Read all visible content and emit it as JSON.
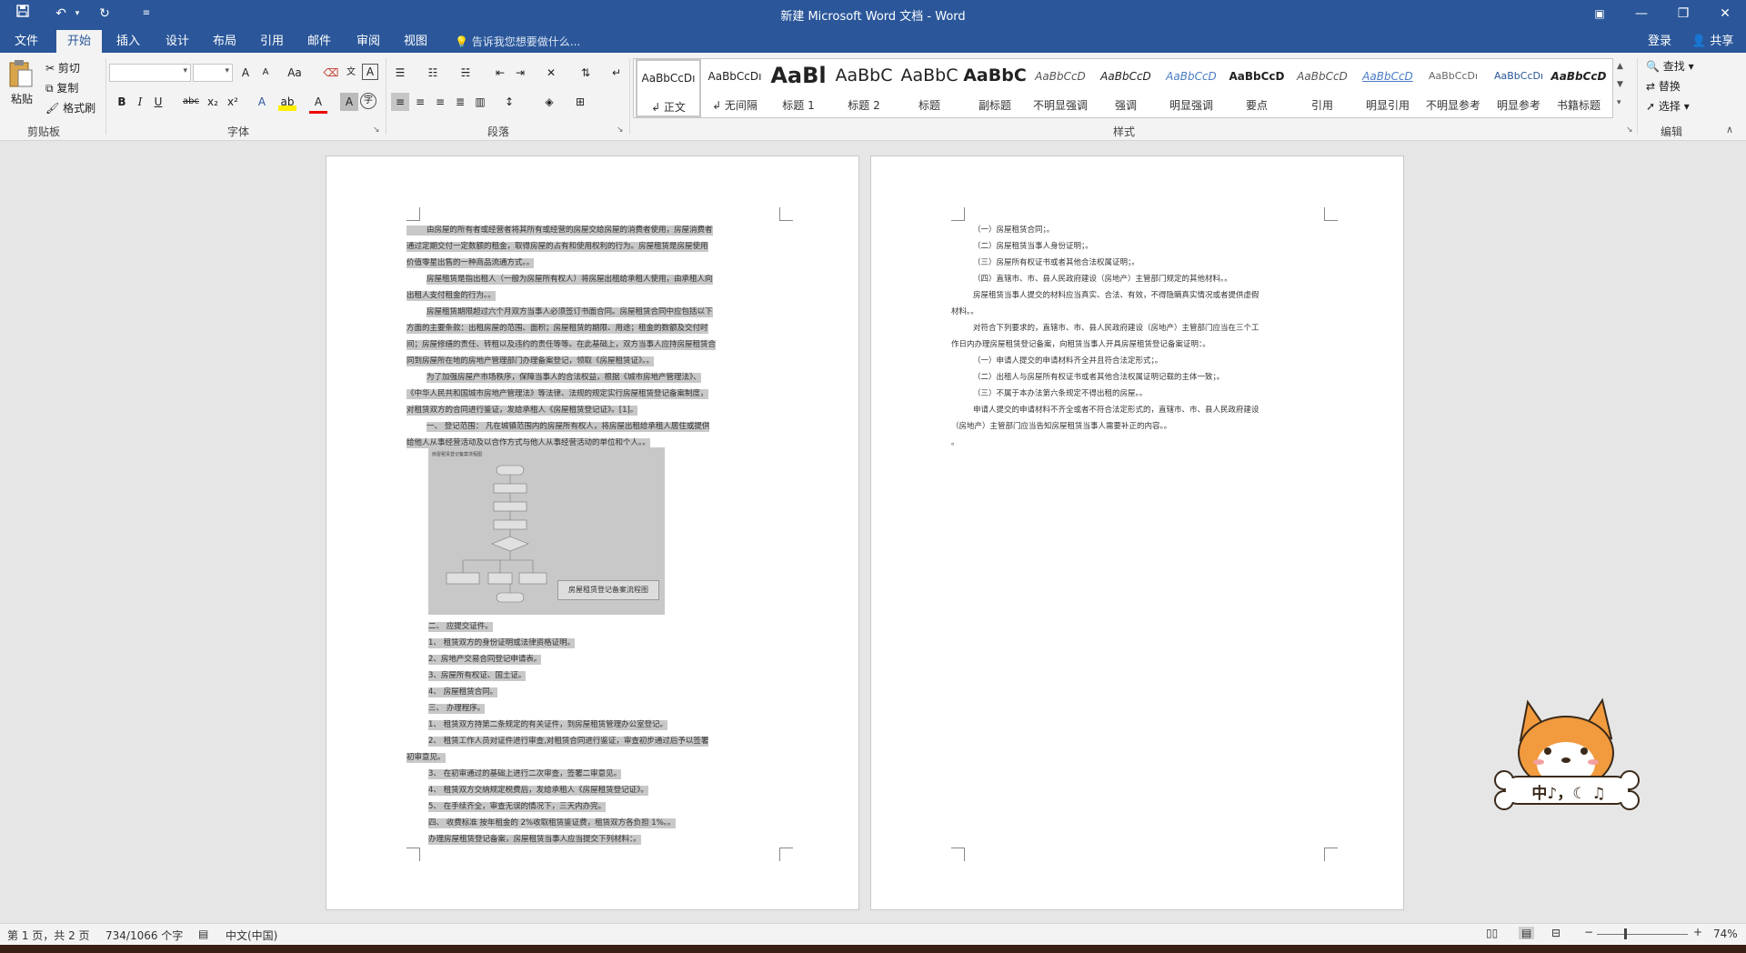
{
  "app": {
    "title": "新建 Microsoft Word 文档 - Word"
  },
  "quick_access": {
    "save_icon": "save-icon",
    "undo_icon": "undo-icon",
    "redo_icon": "redo-icon",
    "customize_icon": "customize-icon"
  },
  "tabs": [
    "文件",
    "开始",
    "插入",
    "设计",
    "布局",
    "引用",
    "邮件",
    "审阅",
    "视图"
  ],
  "active_tab": "开始",
  "tell_me": "告诉我您想要做什么...",
  "account": {
    "login": "登录",
    "share": "共享"
  },
  "clipboard": {
    "paste": "粘贴",
    "cut": "剪切",
    "copy": "复制",
    "format_painter": "格式刷",
    "label": "剪贴板"
  },
  "font": {
    "label": "字体",
    "name": "",
    "size": "",
    "grow": "A",
    "shrink": "A",
    "case": "Aa",
    "bold": "B",
    "italic": "I",
    "underline": "U",
    "strike": "abc",
    "sub": "x₂",
    "sup": "x²"
  },
  "paragraph": {
    "label": "段落"
  },
  "styles": {
    "label": "样式",
    "items": [
      {
        "preview": "AaBbCcDı",
        "name": "↲ 正文"
      },
      {
        "preview": "AaBbCcDı",
        "name": "↲ 无间隔"
      },
      {
        "preview": "AaBl",
        "name": "标题 1"
      },
      {
        "preview": "AaBbC",
        "name": "标题 2"
      },
      {
        "preview": "AaBbC",
        "name": "标题"
      },
      {
        "preview": "AaBbC",
        "name": "副标题"
      },
      {
        "preview": "AaBbCcD",
        "name": "不明显强调"
      },
      {
        "preview": "AaBbCcD",
        "name": "强调"
      },
      {
        "preview": "AaBbCcD",
        "name": "明显强调"
      },
      {
        "preview": "AaBbCcD",
        "name": "要点"
      },
      {
        "preview": "AaBbCcD",
        "name": "引用"
      },
      {
        "preview": "AaBbCcD",
        "name": "明显引用"
      },
      {
        "preview": "AaBbCcDı",
        "name": "不明显参考"
      },
      {
        "preview": "AaBbCcDı",
        "name": "明显参考"
      },
      {
        "preview": "AaBbCcD",
        "name": "书籍标题"
      }
    ]
  },
  "editing": {
    "label": "编辑",
    "find": "查找",
    "replace": "替换",
    "select": "选择"
  },
  "page1": {
    "lines": [
      "由房屋的所有者或经营者将其所有或经营的房屋交给房屋的消费者使用，房屋消费者",
      "通过定期交付一定数额的租金，取得房屋的占有和使用权利的行为。房屋租赁是房屋使用",
      "价值零星出售的一种商品流通方式。。",
      "房屋租赁是指出租人（一般为房屋所有权人）将房屋出租给承租人使用，由承租人向",
      "出租人支付租金的行为。。",
      "房屋租赁期限超过六个月双方当事人必须签订书面合同。房屋租赁合同中应包括以下",
      "方面的主要条款：出租房屋的范围、面积；房屋租赁的期限、用途；租金的数额及交付时",
      "间；房屋修缮的责任、转租以及违约的责任等等。在此基础上，双方当事人应持房屋租赁合",
      "同到房屋所在地的房地产管理部门办理备案登记，领取《房屋租赁证》。。",
      "为了加强房屋产市场秩序，保障当事人的合法权益，根据《城市房地产管理法》、",
      "《中华人民共和国城市房地产管理法》等法律、法规的规定实行房屋租赁登记备案制度，",
      "对租赁双方的合同进行鉴证，发给承租人《房屋租赁登记证》。[1]。",
      "一、 登记范围： 凡在城镇范围内的房屋所有权人，将房屋出租给承租人居住或提供",
      "给他人从事经营活动及以合作方式与他人从事经营活动的单位和个人。。"
    ],
    "flowchart_caption": "房屋租赁登记备案流程图",
    "flowchart_title": "房屋租赁登记备案流程图",
    "list": [
      "二、 应提交证件。",
      "1、 租赁双方的身份证明或法律资格证明。",
      "2、房地产交易合同登记申请表。",
      "3、房屋所有权证、国土证。",
      "4、 房屋租赁合同。",
      "三、 办理程序。",
      "1、 租赁双方持第二条规定的有关证件，到房屋租赁管理办公室登记。",
      "2、 租赁工作人员对证件进行审查,对租赁合同进行鉴证，审查初步通过后予以签署",
      "初审意见。",
      "3、 在初审通过的基础上进行二次审查，签署二审意见。",
      "4、 租赁双方交纳规定税费后，发给承租人《房屋租赁登记证》。",
      "5、 在手续齐全，审查无误的情况下，三天内办完。",
      "四、 收费标准 按年租金的 2%收取租赁鉴证费，租赁双方各负担 1%。。",
      "办理房屋租赁登记备案，房屋租赁当事人应当提交下列材料：。"
    ]
  },
  "page2": {
    "lines": [
      "（一）房屋租赁合同；。",
      "（二）房屋租赁当事人身份证明；。",
      "（三）房屋所有权证书或者其他合法权属证明；。",
      "（四）直辖市、市、县人民政府建设（房地产）主管部门规定的其他材料。。",
      "房屋租赁当事人提交的材料应当真实、合法、有效，不得隐瞒真实情况或者提供虚假",
      "材料。。",
      "对符合下列要求的，直辖市、市、县人民政府建设（房地产）主管部门应当在三个工",
      "作日内办理房屋租赁登记备案，向租赁当事人开具房屋租赁登记备案证明：。",
      "（一）申请人提交的申请材料齐全并且符合法定形式；。",
      "（二）出租人与房屋所有权证书或者其他合法权属证明记载的主体一致；。",
      "（三）不属于本办法第六条规定不得出租的房屋。。",
      "申请人提交的申请材料不齐全或者不符合法定形式的，直辖市、市、县人民政府建设",
      "（房地产）主管部门应当告知房屋租赁当事人需要补正的内容。。",
      "。"
    ]
  },
  "status": {
    "page": "第 1 页，共 2 页",
    "words": "734/1066 个字",
    "language": "中文(中国)",
    "zoom": "74%"
  },
  "sticker": {
    "text": "中♪，☾ ♫"
  }
}
